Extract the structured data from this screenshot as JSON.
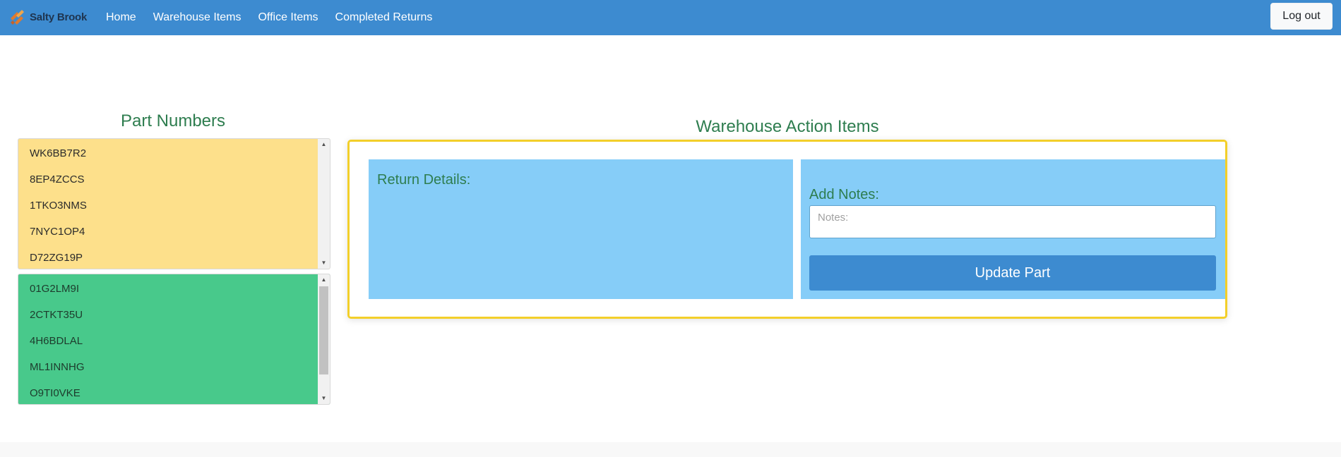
{
  "navbar": {
    "brand": "Salty Brook",
    "links": [
      "Home",
      "Warehouse Items",
      "Office Items",
      "Completed Returns"
    ],
    "logout_label": "Log out"
  },
  "parts": {
    "heading": "Part Numbers",
    "pending": [
      "WK6BB7R2",
      "8EP4ZCCS",
      "1TKO3NMS",
      "7NYC1OP4",
      "D72ZG19P"
    ],
    "complete": [
      "01G2LM9I",
      "2CTKT35U",
      "4H6BDLAL",
      "ML1INNHG",
      "O9TI0VKE"
    ]
  },
  "actions": {
    "heading": "Warehouse Action Items",
    "details_label": "Return Details:",
    "notes_label": "Add Notes:",
    "notes_placeholder": "Notes:",
    "notes_value": "",
    "update_label": "Update Part"
  },
  "colors": {
    "navbar": "#3d8bd0",
    "pending_list": "#fde08b",
    "complete_list": "#48c98b",
    "panel": "#86cdf8",
    "action_border": "#f3cf2a",
    "heading_text": "#2e7d4f"
  }
}
